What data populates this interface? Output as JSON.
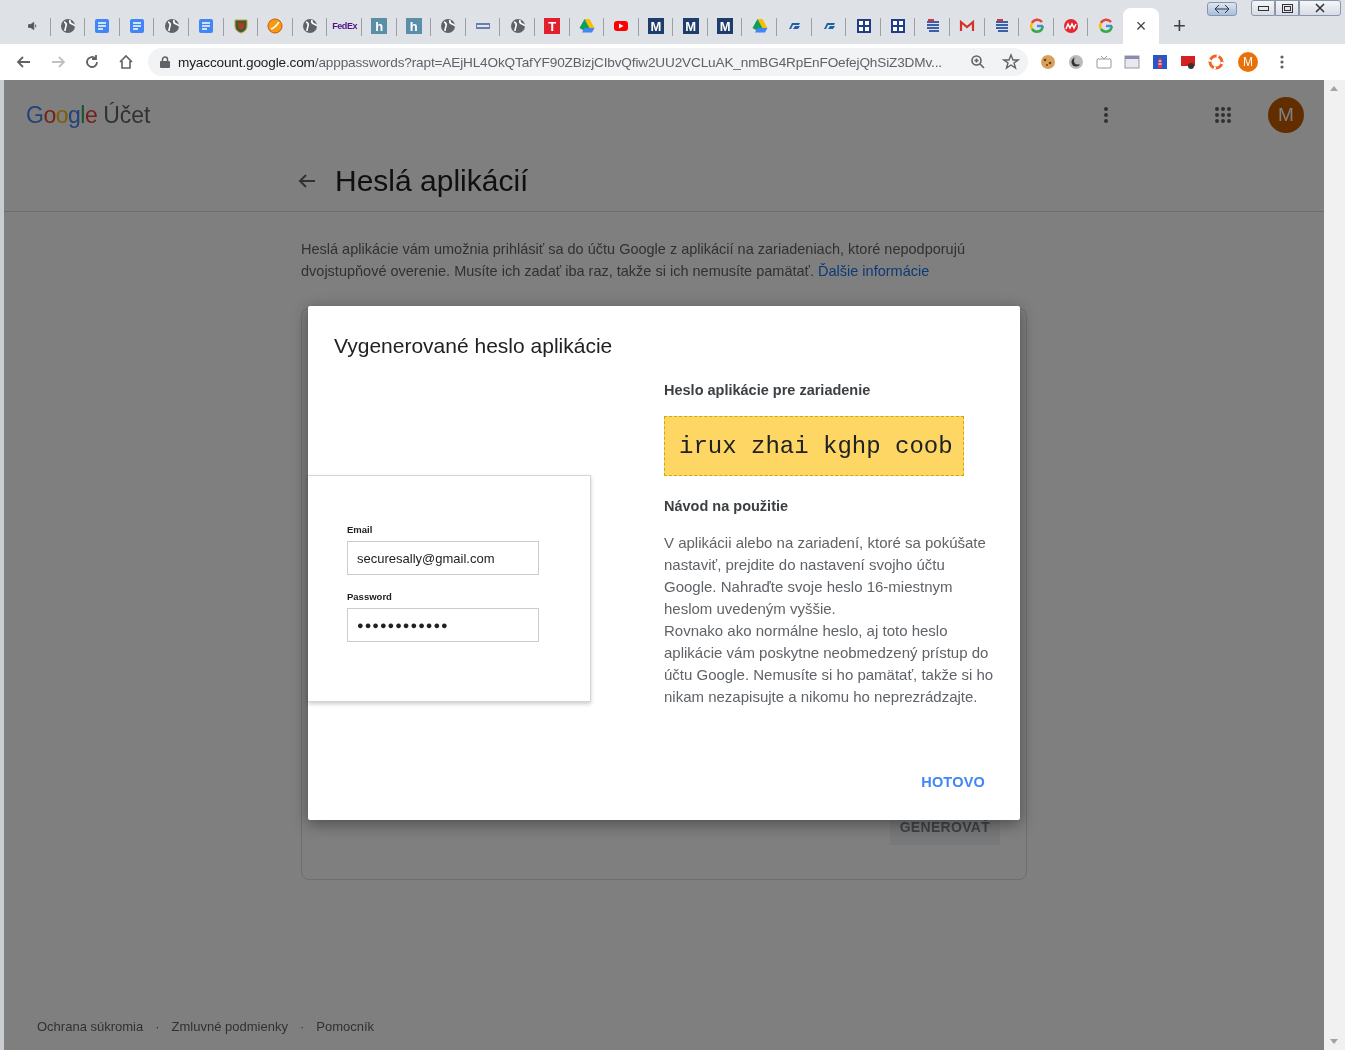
{
  "browser": {
    "tabs": [
      {
        "kind": "audio",
        "selected": false
      },
      {
        "kind": "globe",
        "selected": false
      },
      {
        "kind": "doc",
        "selected": false
      },
      {
        "kind": "doc",
        "selected": false
      },
      {
        "kind": "globe",
        "selected": false
      },
      {
        "kind": "doc",
        "selected": false
      },
      {
        "kind": "shield",
        "selected": false
      },
      {
        "kind": "swoosh",
        "selected": false
      },
      {
        "kind": "globe",
        "selected": false
      },
      {
        "kind": "wordmark",
        "glyph": "FedEx",
        "selected": false
      },
      {
        "kind": "letter",
        "glyph": "h",
        "color": "#5b8fa8",
        "selected": false
      },
      {
        "kind": "letter",
        "glyph": "h",
        "color": "#5b8fa8",
        "selected": false
      },
      {
        "kind": "globe",
        "selected": false
      },
      {
        "kind": "bar",
        "selected": false
      },
      {
        "kind": "globe",
        "selected": false
      },
      {
        "kind": "letter",
        "glyph": "T",
        "color": "#e0202f",
        "selected": false
      },
      {
        "kind": "drive",
        "selected": false
      },
      {
        "kind": "youtube",
        "selected": false
      },
      {
        "kind": "letter",
        "glyph": "M",
        "color": "#1f3d6b",
        "selected": false
      },
      {
        "kind": "letter",
        "glyph": "M",
        "color": "#1f3d6b",
        "selected": false
      },
      {
        "kind": "letter",
        "glyph": "M",
        "color": "#1f3d6b",
        "selected": false
      },
      {
        "kind": "drive",
        "selected": false
      },
      {
        "kind": "st",
        "selected": false
      },
      {
        "kind": "st",
        "selected": false
      },
      {
        "kind": "grid",
        "selected": false
      },
      {
        "kind": "grid",
        "selected": false
      },
      {
        "kind": "stripes",
        "selected": false
      },
      {
        "kind": "gmail",
        "selected": false
      },
      {
        "kind": "stripes",
        "selected": false
      },
      {
        "kind": "google",
        "selected": false
      },
      {
        "kind": "chip",
        "selected": false
      },
      {
        "kind": "google",
        "selected": false
      },
      {
        "kind": "close",
        "close": "×",
        "selected": true
      }
    ],
    "new_tab": "+",
    "url_host": "myaccount.google.com",
    "url_path": "/apppasswords?rapt=AEjHL4OkQTafYF90ZBizjCIbvQfiw2UU2VCLuAK_nmBG4RpEnFOefejQhSiZ3DMv...",
    "profile": "M"
  },
  "page": {
    "logo": "Google",
    "product": "Účet",
    "avatar": "M",
    "title": "Heslá aplikácií",
    "intro": "Heslá aplikácie vám umožnia prihlásiť sa do účtu Google z aplikácií na zariadeniach, ktoré nepodporujú dvojstupňové overenie. Musíte ich zadať iba raz, takže si ich nemusíte pamätať.",
    "intro_link": "Ďalšie informácie",
    "generate_button": "GENEROVAŤ",
    "footer": [
      "Ochrana súkromia",
      "·",
      "Zmluvné podmienky",
      "·",
      "Pomocník"
    ]
  },
  "dialog": {
    "title": "Vygenerované heslo aplikácie",
    "illustration": {
      "email_label": "Email",
      "email_value": "securesally@gmail.com",
      "password_label": "Password",
      "password_value": "●●●●●●●●●●●●"
    },
    "password_heading": "Heslo aplikácie pre zariadenie",
    "password": "irux zhai kghp coob",
    "howto_heading": "Návod na použitie",
    "howto": [
      "V aplikácii alebo na zariadení, ktoré sa pokúšate nastaviť, prejdite do nastavení svojho účtu Google. Nahraďte svoje heslo 16-miestnym heslom uvedeným vyššie.",
      "Rovnako ako normálne heslo, aj toto heslo aplikácie vám poskytne neobmedzený prístup do účtu Google. Nemusíte si ho pamätať, takže si ho nikam nezapisujte a nikomu ho neprezrádzajte."
    ],
    "done_button": "HOTOVO"
  }
}
